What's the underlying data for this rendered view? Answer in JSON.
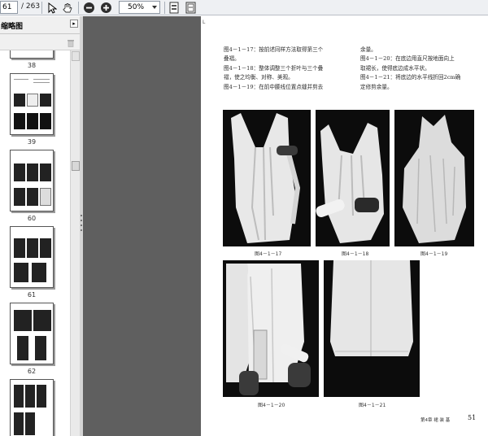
{
  "toolbar": {
    "page_current": "61",
    "page_total": "/ 263",
    "zoom_value": "50%"
  },
  "sidebar": {
    "title": "缩略图",
    "thumbnails": [
      {
        "label": "38"
      },
      {
        "label": "39"
      },
      {
        "label": "60"
      },
      {
        "label": "61"
      },
      {
        "label": "62"
      },
      {
        "label": ""
      }
    ]
  },
  "document": {
    "crop_mark": "L",
    "left_column": [
      "图4－1－17：按前述同样方法取得第三个",
      "叠褶。",
      "图4－1－18：整体调整三个折叶与三个叠",
      "褶，使之均衡、对称、美观。",
      "图4－1－19：在前中腰线位置点缝并剪去"
    ],
    "right_column": [
      "余量。",
      "图4－1－20：在底边用直尺按地面向上",
      "取裙长，使得底边成水平状。",
      "图4－1－21：将底边的水平线折回2cm确",
      "定修剪余量。"
    ],
    "captions": [
      "图4－1－17",
      "图4－1－18",
      "图4－1－19",
      "图4－1－20",
      "图4－1－21"
    ],
    "footer_text": "第4章 裙  装  基",
    "page_number": "51"
  },
  "colors": {
    "toolbar_bg": "#eef0f3",
    "doc_background": "#5f5f5f",
    "page": "#ffffff",
    "photo_bg": "#000000"
  }
}
